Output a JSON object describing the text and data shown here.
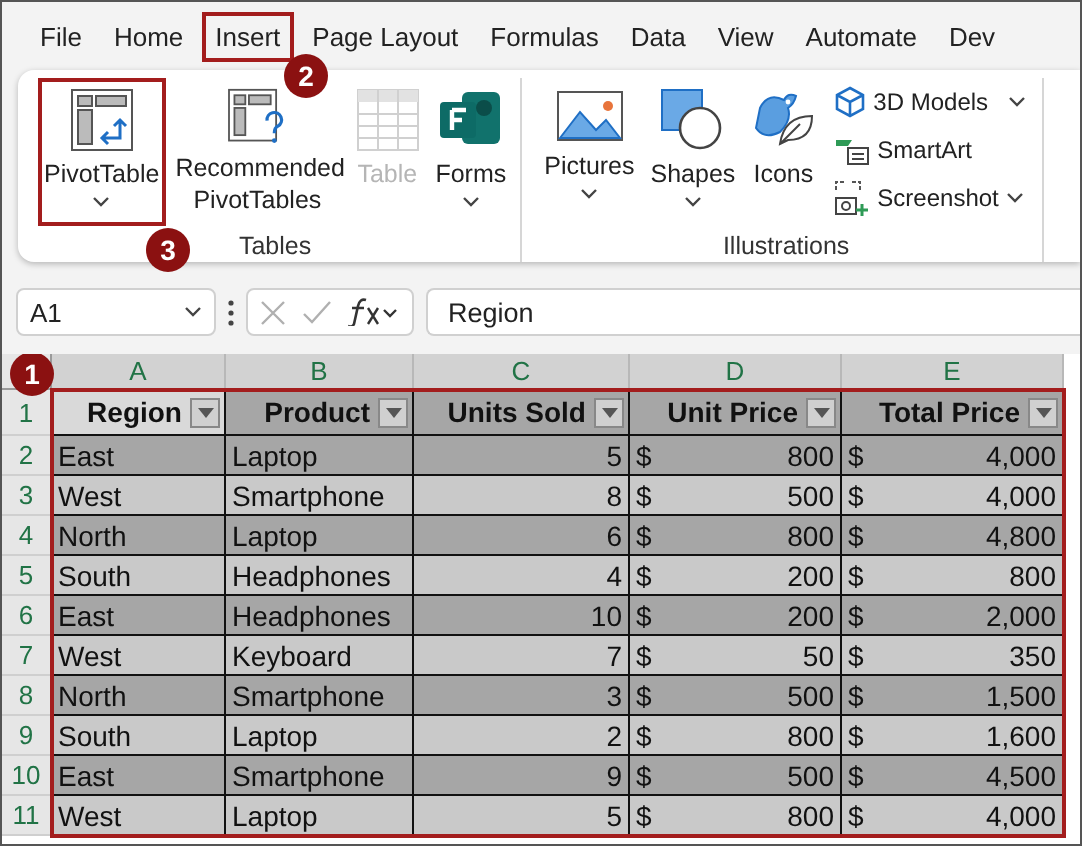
{
  "menu_tabs": [
    {
      "label": "File",
      "selected": false
    },
    {
      "label": "Home",
      "selected": false
    },
    {
      "label": "Insert",
      "selected": true,
      "callout": "2"
    },
    {
      "label": "Page Layout",
      "selected": false
    },
    {
      "label": "Formulas",
      "selected": false
    },
    {
      "label": "Data",
      "selected": false
    },
    {
      "label": "View",
      "selected": false
    },
    {
      "label": "Automate",
      "selected": false
    },
    {
      "label": "Dev",
      "selected": false
    }
  ],
  "ribbon": {
    "groups": [
      {
        "label": "Tables",
        "buttons": [
          {
            "kind": "large",
            "label": "PivotTable",
            "dropdown": true,
            "disabled": false,
            "callout": "3"
          },
          {
            "kind": "large",
            "label": "Recommended PivotTables",
            "dropdown": false,
            "disabled": false
          },
          {
            "kind": "large",
            "label": "Table",
            "dropdown": false,
            "disabled": true
          },
          {
            "kind": "large",
            "label": "Forms",
            "dropdown": true,
            "disabled": false
          }
        ]
      },
      {
        "label": "Illustrations",
        "buttons": [
          {
            "kind": "large",
            "label": "Pictures",
            "dropdown": true,
            "disabled": false
          },
          {
            "kind": "large",
            "label": "Shapes",
            "dropdown": true,
            "disabled": false
          },
          {
            "kind": "large",
            "label": "Icons",
            "dropdown": false,
            "disabled": false
          },
          {
            "kind": "small",
            "label": "3D Models",
            "dropdown": true,
            "disabled": false
          },
          {
            "kind": "small",
            "label": "SmartArt",
            "dropdown": false,
            "disabled": false
          },
          {
            "kind": "small",
            "label": "Screenshot",
            "dropdown": true,
            "disabled": false
          }
        ]
      }
    ]
  },
  "formula_bar": {
    "name_box": "A1",
    "formula": "Region"
  },
  "sheet": {
    "columns": [
      "A",
      "B",
      "C",
      "D",
      "E"
    ],
    "row_numbers": [
      "1",
      "2",
      "3",
      "4",
      "5",
      "6",
      "7",
      "8",
      "9",
      "10",
      "11"
    ],
    "callout": "1",
    "headers": [
      {
        "label": "Region",
        "selected": true
      },
      {
        "label": "Product",
        "selected": false
      },
      {
        "label": "Units Sold",
        "selected": false
      },
      {
        "label": "Unit Price",
        "selected": false
      },
      {
        "label": "Total Price",
        "selected": false
      }
    ],
    "rows": [
      {
        "region": "East",
        "product": "Laptop",
        "units_sold": "5",
        "unit_price": {
          "currency": "$",
          "amount": "800"
        },
        "total_price": {
          "currency": "$",
          "amount": "4,000"
        }
      },
      {
        "region": "West",
        "product": "Smartphone",
        "units_sold": "8",
        "unit_price": {
          "currency": "$",
          "amount": "500"
        },
        "total_price": {
          "currency": "$",
          "amount": "4,000"
        }
      },
      {
        "region": "North",
        "product": "Laptop",
        "units_sold": "6",
        "unit_price": {
          "currency": "$",
          "amount": "800"
        },
        "total_price": {
          "currency": "$",
          "amount": "4,800"
        }
      },
      {
        "region": "South",
        "product": "Headphones",
        "units_sold": "4",
        "unit_price": {
          "currency": "$",
          "amount": "200"
        },
        "total_price": {
          "currency": "$",
          "amount": "800"
        }
      },
      {
        "region": "East",
        "product": "Headphones",
        "units_sold": "10",
        "unit_price": {
          "currency": "$",
          "amount": "200"
        },
        "total_price": {
          "currency": "$",
          "amount": "2,000"
        }
      },
      {
        "region": "West",
        "product": "Keyboard",
        "units_sold": "7",
        "unit_price": {
          "currency": "$",
          "amount": "50"
        },
        "total_price": {
          "currency": "$",
          "amount": "350"
        }
      },
      {
        "region": "North",
        "product": "Smartphone",
        "units_sold": "3",
        "unit_price": {
          "currency": "$",
          "amount": "500"
        },
        "total_price": {
          "currency": "$",
          "amount": "1,500"
        }
      },
      {
        "region": "South",
        "product": "Laptop",
        "units_sold": "2",
        "unit_price": {
          "currency": "$",
          "amount": "800"
        },
        "total_price": {
          "currency": "$",
          "amount": "1,600"
        }
      },
      {
        "region": "East",
        "product": "Smartphone",
        "units_sold": "9",
        "unit_price": {
          "currency": "$",
          "amount": "500"
        },
        "total_price": {
          "currency": "$",
          "amount": "4,500"
        }
      },
      {
        "region": "West",
        "product": "Laptop",
        "units_sold": "5",
        "unit_price": {
          "currency": "$",
          "amount": "800"
        },
        "total_price": {
          "currency": "$",
          "amount": "4,000"
        }
      }
    ]
  }
}
